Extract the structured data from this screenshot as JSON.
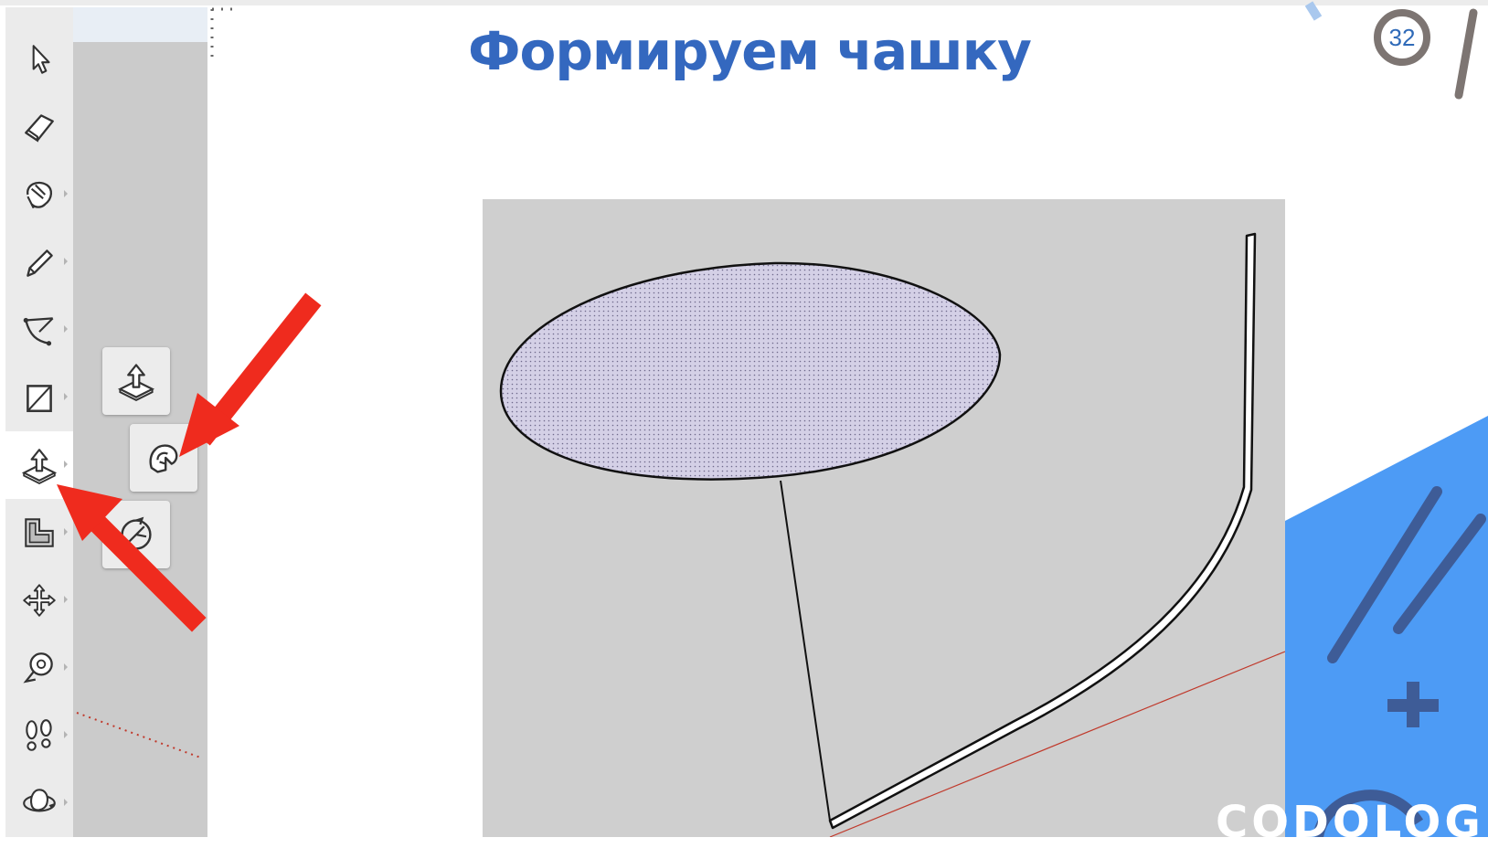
{
  "slide": {
    "title": "Формируем чашку",
    "page_number": "32",
    "brand": "CODOLOGIA"
  },
  "toolbar": {
    "tools": [
      {
        "name": "select-tool",
        "icon": "arrow-cursor-icon"
      },
      {
        "name": "eraser-tool",
        "icon": "eraser-icon"
      },
      {
        "name": "paint-bucket-tool",
        "icon": "paint-bucket-icon"
      },
      {
        "name": "pencil-tool",
        "icon": "pencil-icon"
      },
      {
        "name": "arc-tool",
        "icon": "arc-icon"
      },
      {
        "name": "rectangle-tool",
        "icon": "rectangle-icon"
      },
      {
        "name": "push-pull-tool",
        "icon": "push-pull-icon",
        "active": true
      },
      {
        "name": "offset-tool",
        "icon": "offset-icon"
      },
      {
        "name": "move-tool",
        "icon": "move-icon"
      },
      {
        "name": "tape-measure-tool",
        "icon": "tape-measure-icon"
      },
      {
        "name": "walk-tool",
        "icon": "footprints-icon"
      },
      {
        "name": "orbit-tool",
        "icon": "orbit-icon"
      }
    ],
    "flyout": [
      {
        "name": "push-pull-option",
        "icon": "push-pull-icon"
      },
      {
        "name": "follow-me-option",
        "icon": "follow-me-icon"
      },
      {
        "name": "rotate-option",
        "icon": "rotate-icon"
      }
    ]
  },
  "colors": {
    "title": "#3468bf",
    "arrow": "#ef2b1e",
    "accent_blue": "#4d9bf5",
    "dark_blue": "#3e5c97",
    "viewport_bg": "#cfcfcf",
    "ellipse_fill": "#cdcae0"
  }
}
